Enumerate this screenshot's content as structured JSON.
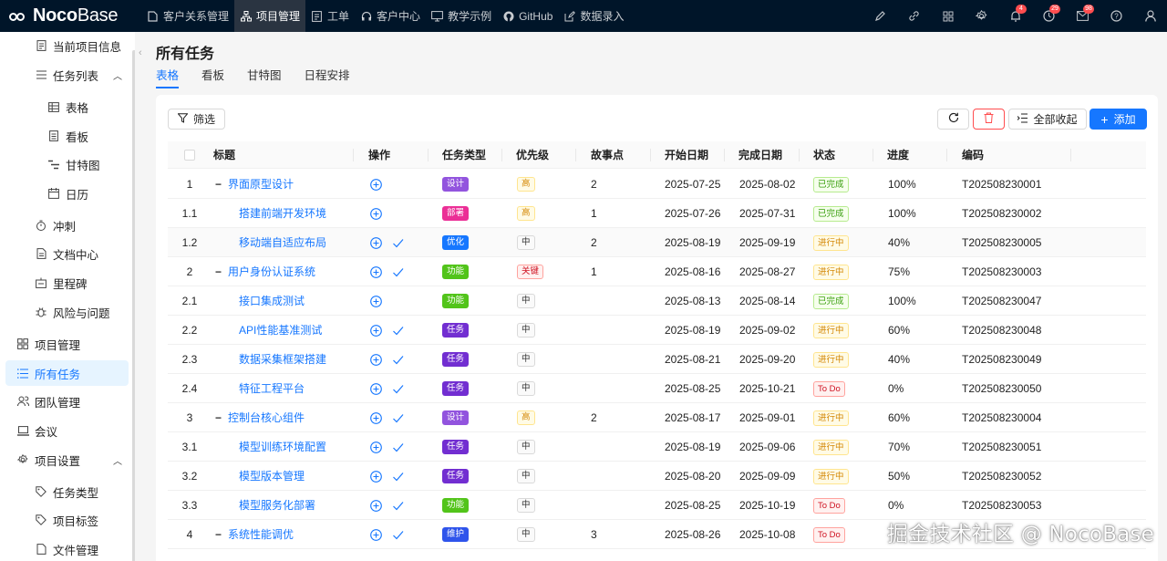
{
  "app": {
    "logo_bold": "Noco",
    "logo_light": "Base"
  },
  "topnav": [
    {
      "label": "客户关系管理",
      "icon": "file-icon"
    },
    {
      "label": "项目管理",
      "icon": "tree-icon",
      "active": true
    },
    {
      "label": "工单",
      "icon": "list-icon"
    },
    {
      "label": "客户中心",
      "icon": "headset-icon"
    },
    {
      "label": "教学示例",
      "icon": "monitor-icon"
    },
    {
      "label": "GitHub",
      "icon": "github-icon"
    },
    {
      "label": "数据录入",
      "icon": "edit-icon"
    }
  ],
  "topright": {
    "badges": {
      "bell": "4",
      "clock": "29",
      "mail": "98"
    }
  },
  "sidebar": {
    "items": [
      {
        "label": "当前项目信息",
        "icon": "doc-icon"
      },
      {
        "label": "任务列表",
        "icon": "menu-icon"
      },
      {
        "label": "表格",
        "icon": "table-icon"
      },
      {
        "label": "看板",
        "icon": "board-icon"
      },
      {
        "label": "甘特图",
        "icon": "gantt-icon"
      },
      {
        "label": "日历",
        "icon": "calendar-icon"
      },
      {
        "label": "冲刺",
        "icon": "timer-icon"
      },
      {
        "label": "文档中心",
        "icon": "file-icon"
      },
      {
        "label": "里程碑",
        "icon": "flag-icon"
      },
      {
        "label": "风险与问题",
        "icon": "bug-icon"
      },
      {
        "label": "项目管理",
        "icon": "project-icon"
      },
      {
        "label": "所有任务",
        "icon": "list-icon"
      },
      {
        "label": "团队管理",
        "icon": "team-icon"
      },
      {
        "label": "会议",
        "icon": "laptop-icon"
      },
      {
        "label": "项目设置",
        "icon": "gear-icon"
      },
      {
        "label": "任务类型",
        "icon": "tag-icon"
      },
      {
        "label": "项目标签",
        "icon": "tags-icon"
      },
      {
        "label": "文件管理",
        "icon": "file-icon"
      }
    ]
  },
  "page": {
    "title": "所有任务",
    "tabs": [
      "表格",
      "看板",
      "甘特图",
      "日程安排"
    ]
  },
  "toolbar": {
    "filter": "筛选",
    "collapse_all": "全部收起",
    "add": "添加"
  },
  "table": {
    "columns": [
      "标题",
      "操作",
      "任务类型",
      "优先级",
      "故事点",
      "开始日期",
      "完成日期",
      "状态",
      "进度",
      "编码"
    ],
    "rows": [
      {
        "idx": "1",
        "level": 0,
        "expand": "−",
        "title": "界面原型设计",
        "check": false,
        "type": "设计",
        "priority": "高",
        "points": "2",
        "start": "2025-07-25",
        "end": "2025-08-02",
        "status": "已完成",
        "progress": "100%",
        "code": "T202508230001"
      },
      {
        "idx": "1.1",
        "level": 1,
        "title": "搭建前端开发环境",
        "check": false,
        "type": "部署",
        "priority": "高",
        "points": "1",
        "start": "2025-07-26",
        "end": "2025-07-31",
        "status": "已完成",
        "progress": "100%",
        "code": "T202508230002"
      },
      {
        "idx": "1.2",
        "level": 1,
        "title": "移动端自适应布局",
        "check": true,
        "type": "优化",
        "priority": "中",
        "points": "2",
        "start": "2025-08-19",
        "end": "2025-09-19",
        "status": "进行中",
        "progress": "40%",
        "code": "T202508230005"
      },
      {
        "idx": "2",
        "level": 0,
        "expand": "−",
        "title": "用户身份认证系统",
        "check": true,
        "type": "功能",
        "priority": "关键",
        "points": "1",
        "start": "2025-08-16",
        "end": "2025-08-27",
        "status": "进行中",
        "progress": "75%",
        "code": "T202508230003"
      },
      {
        "idx": "2.1",
        "level": 1,
        "title": "接口集成测试",
        "check": false,
        "type": "功能",
        "priority": "中",
        "points": "",
        "start": "2025-08-13",
        "end": "2025-08-14",
        "status": "已完成",
        "progress": "100%",
        "code": "T202508230047"
      },
      {
        "idx": "2.2",
        "level": 1,
        "title": "API性能基准测试",
        "check": true,
        "type": "任务",
        "priority": "中",
        "points": "",
        "start": "2025-08-19",
        "end": "2025-09-02",
        "status": "进行中",
        "progress": "60%",
        "code": "T202508230048"
      },
      {
        "idx": "2.3",
        "level": 1,
        "title": "数据采集框架搭建",
        "check": true,
        "type": "任务",
        "priority": "中",
        "points": "",
        "start": "2025-08-21",
        "end": "2025-09-20",
        "status": "进行中",
        "progress": "40%",
        "code": "T202508230049"
      },
      {
        "idx": "2.4",
        "level": 1,
        "title": "特征工程平台",
        "check": true,
        "type": "任务",
        "priority": "中",
        "points": "",
        "start": "2025-08-25",
        "end": "2025-10-21",
        "status": "To Do",
        "progress": "0%",
        "code": "T202508230050"
      },
      {
        "idx": "3",
        "level": 0,
        "expand": "−",
        "title": "控制台核心组件",
        "check": true,
        "type": "设计",
        "priority": "高",
        "points": "2",
        "start": "2025-08-17",
        "end": "2025-09-01",
        "status": "进行中",
        "progress": "60%",
        "code": "T202508230004"
      },
      {
        "idx": "3.1",
        "level": 1,
        "title": "模型训练环境配置",
        "check": true,
        "type": "任务",
        "priority": "中",
        "points": "",
        "start": "2025-08-19",
        "end": "2025-09-06",
        "status": "进行中",
        "progress": "70%",
        "code": "T202508230051"
      },
      {
        "idx": "3.2",
        "level": 1,
        "title": "模型版本管理",
        "check": true,
        "type": "任务",
        "priority": "中",
        "points": "",
        "start": "2025-08-20",
        "end": "2025-09-09",
        "status": "进行中",
        "progress": "50%",
        "code": "T202508230052"
      },
      {
        "idx": "3.3",
        "level": 1,
        "title": "模型服务化部署",
        "check": true,
        "type": "功能",
        "priority": "中",
        "points": "",
        "start": "2025-08-25",
        "end": "2025-10-19",
        "status": "To Do",
        "progress": "0%",
        "code": "T202508230053"
      },
      {
        "idx": "4",
        "level": 0,
        "expand": "−",
        "title": "系统性能调优",
        "check": true,
        "type": "维护",
        "priority": "中",
        "points": "3",
        "start": "2025-08-26",
        "end": "2025-10-08",
        "status": "To Do",
        "progress": "",
        "code": ""
      }
    ]
  },
  "colors": {
    "type": {
      "设计": "#9254de",
      "部署": "#eb2f96",
      "优化": "#1677ff",
      "功能": "#52c41a",
      "任务": "#722ed1",
      "维护": "#2f54eb"
    },
    "status": {
      "已完成": {
        "fg": "#389e0d",
        "bg": "#f6ffed",
        "bd": "#b7eb8f"
      },
      "进行中": {
        "fg": "#d48806",
        "bg": "#fffbe6",
        "bd": "#ffe58f"
      },
      "To Do": {
        "fg": "#cf1322",
        "bg": "#fff1f0",
        "bd": "#ffa39e"
      }
    },
    "priority": {
      "高": {
        "fg": "#d48806",
        "bg": "#fffbe6",
        "bd": "#ffe58f"
      },
      "中": {
        "fg": "#333333",
        "bg": "#fafafa",
        "bd": "#d9d9d9"
      },
      "关键": {
        "fg": "#cf1322",
        "bg": "#fff1f0",
        "bd": "#ffa39e"
      }
    }
  },
  "watermark": "掘金技术社区 @ NocoBase"
}
